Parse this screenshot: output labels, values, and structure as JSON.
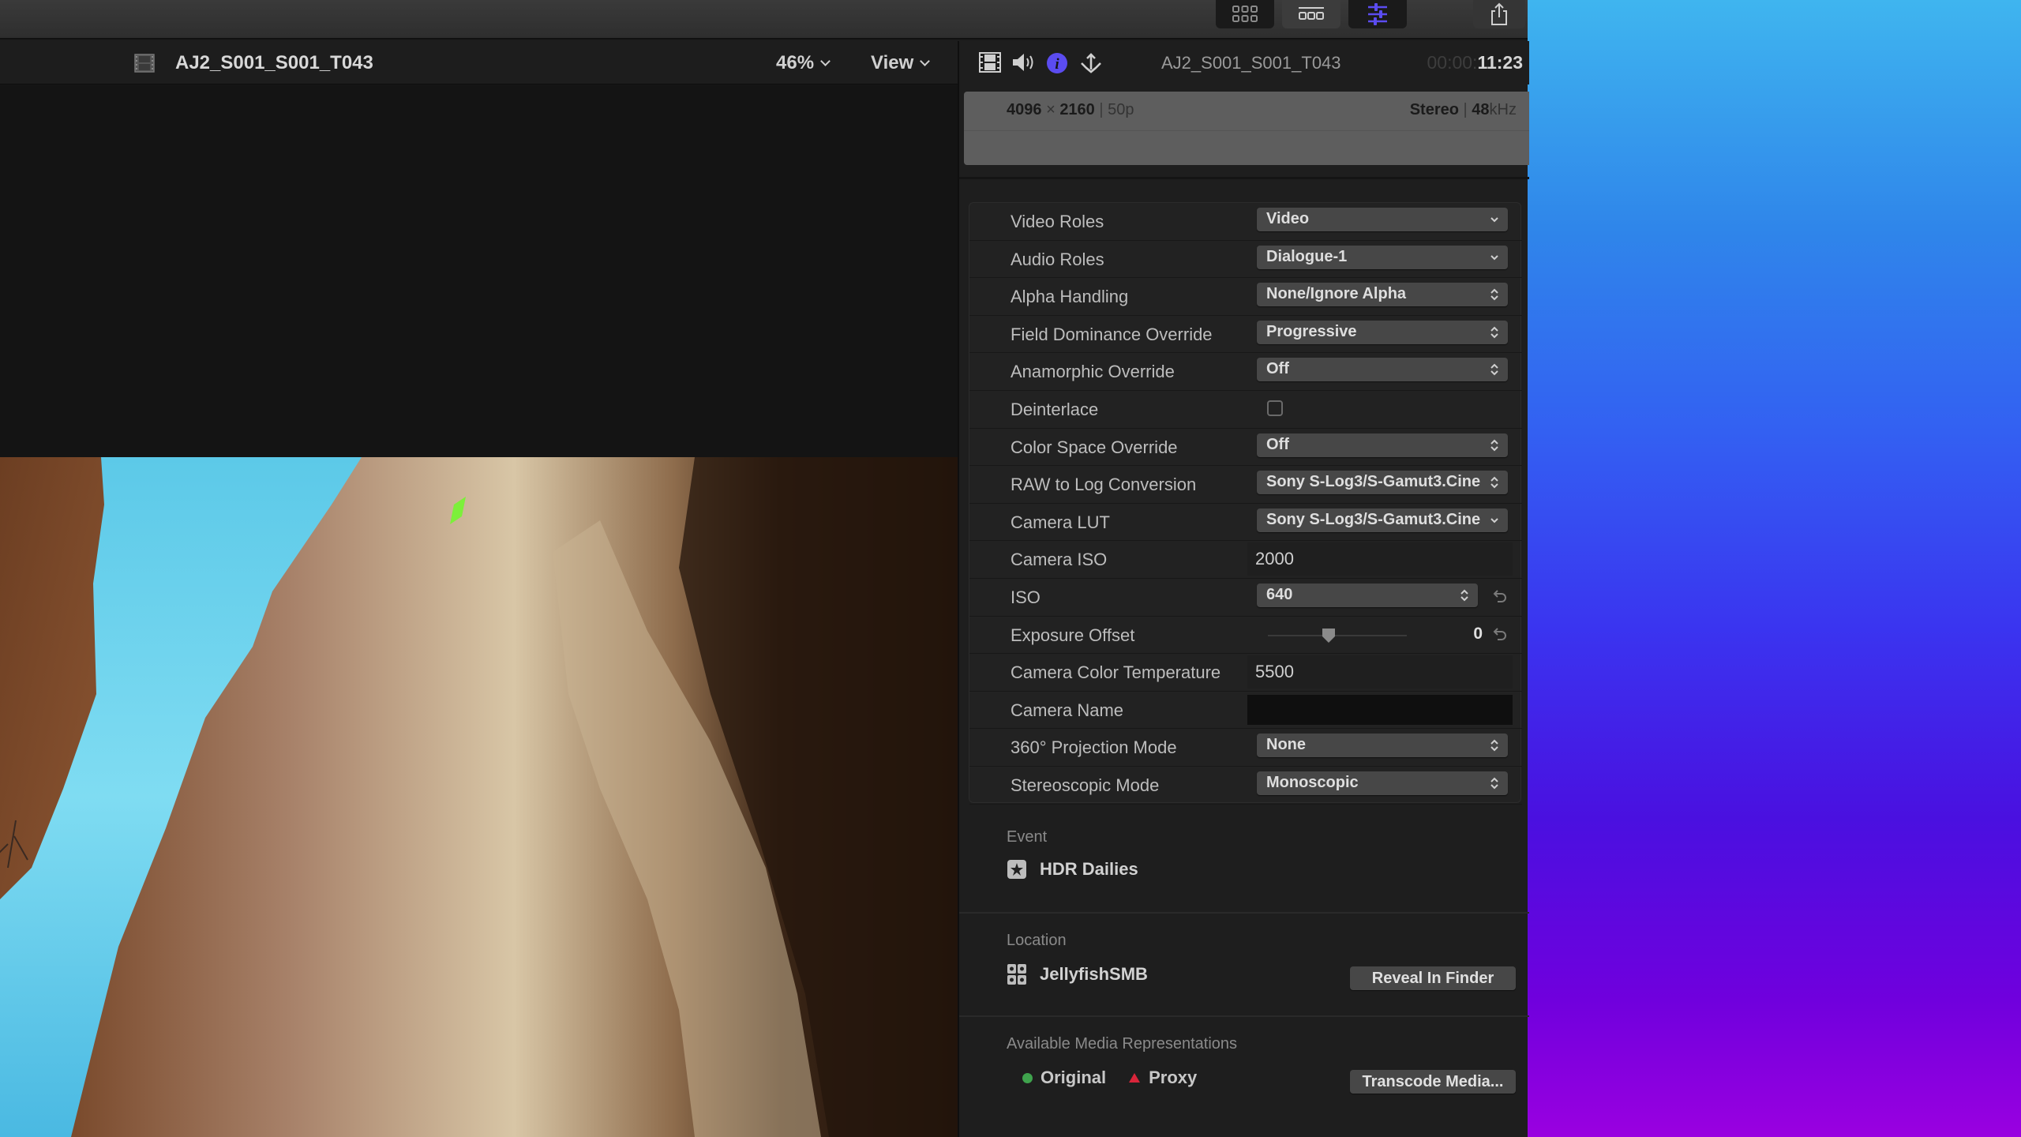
{
  "toolbar": {
    "buttons": [
      {
        "name": "browser-grid",
        "icon": "grid-icon"
      },
      {
        "name": "timeline-index",
        "icon": "filmstrip-icon"
      },
      {
        "name": "inspector-toggle",
        "icon": "sliders-icon",
        "active": true
      },
      {
        "name": "share",
        "icon": "share-icon"
      }
    ]
  },
  "viewer": {
    "clip_name": "AJ2_S001_S001_T043",
    "zoom_level": "46%",
    "view_menu": "View"
  },
  "inspector": {
    "tabs": [
      {
        "name": "video",
        "icon": "film-icon"
      },
      {
        "name": "audio",
        "icon": "speaker-icon"
      },
      {
        "name": "info",
        "icon": "info-icon",
        "active": true
      },
      {
        "name": "share",
        "icon": "share-arrows-icon"
      }
    ],
    "clip_name": "AJ2_S001_S001_T043",
    "timecode_dim": "00:00:",
    "timecode_bright": "11:23",
    "banner": {
      "resolution_w": "4096",
      "resolution_x": "×",
      "resolution_h": "2160",
      "separator": "|",
      "frame_rate": "50p",
      "audio_channels": "Stereo",
      "sample_rate_num": "48",
      "sample_rate_unit": "kHz"
    },
    "properties": [
      {
        "label": "Video Roles",
        "type": "dropdown",
        "value": "Video",
        "arrow": "chevron"
      },
      {
        "label": "Audio Roles",
        "type": "dropdown",
        "value": "Dialogue-1",
        "arrow": "chevron"
      },
      {
        "label": "Alpha Handling",
        "type": "dropdown",
        "value": "None/Ignore Alpha",
        "arrow": "stepper"
      },
      {
        "label": "Field Dominance Override",
        "type": "dropdown",
        "value": "Progressive",
        "arrow": "stepper"
      },
      {
        "label": "Anamorphic Override",
        "type": "dropdown",
        "value": "Off",
        "arrow": "stepper"
      },
      {
        "label": "Deinterlace",
        "type": "checkbox",
        "checked": false
      },
      {
        "label": "Color Space Override",
        "type": "dropdown",
        "value": "Off",
        "arrow": "stepper"
      },
      {
        "label": "RAW to Log Conversion",
        "type": "dropdown",
        "value": "Sony S-Log3/S-Gamut3.Cine",
        "arrow": "stepper"
      },
      {
        "label": "Camera LUT",
        "type": "dropdown",
        "value": "Sony S-Log3/S-Gamut3.Cine",
        "arrow": "chevron"
      },
      {
        "label": "Camera ISO",
        "type": "text",
        "value": "2000"
      },
      {
        "label": "ISO",
        "type": "dropdown-reset",
        "value": "640",
        "arrow": "stepper"
      },
      {
        "label": "Exposure Offset",
        "type": "slider",
        "value": "0"
      },
      {
        "label": "Camera Color Temperature",
        "type": "text",
        "value": "5500"
      },
      {
        "label": "Camera Name",
        "type": "input",
        "value": ""
      },
      {
        "label": "360° Projection Mode",
        "type": "dropdown",
        "value": "None",
        "arrow": "stepper"
      },
      {
        "label": "Stereoscopic Mode",
        "type": "dropdown",
        "value": "Monoscopic",
        "arrow": "stepper"
      }
    ],
    "event": {
      "label": "Event",
      "value": "HDR Dailies"
    },
    "location": {
      "label": "Location",
      "value": "JellyfishSMB",
      "button": "Reveal In Finder"
    },
    "media": {
      "label": "Available Media Representations",
      "original": "Original",
      "proxy": "Proxy",
      "original_color": "#3fa34d",
      "proxy_color": "#d9253a",
      "button": "Transcode Media..."
    }
  },
  "colors": {
    "accent": "#5b4cf0"
  }
}
